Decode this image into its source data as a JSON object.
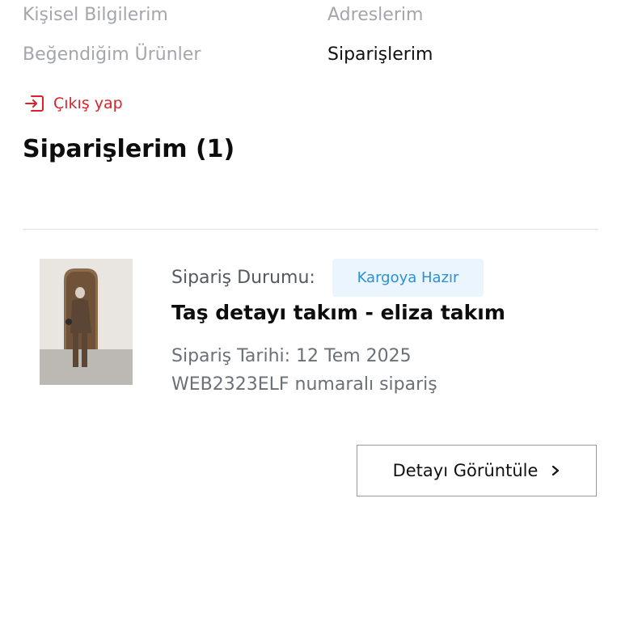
{
  "account_nav": {
    "personal_info": "Kişisel Bilgilerim",
    "addresses": "Adreslerim",
    "liked_products": "Beğendiğim Ürünler",
    "orders": "Siparişlerim",
    "active": "orders"
  },
  "logout": {
    "label": "Çıkış yap",
    "icon": "logout-icon",
    "color": "#d8232a"
  },
  "page": {
    "title": "Siparişlerim (1)"
  },
  "orders": [
    {
      "status_label": "Sipariş Durumu:",
      "status_value": "Kargoya Hazır",
      "status_color": "#2e8fd6",
      "product_name": "Taş detayı takım - eliza takım",
      "order_date": "Sipariş Tarihi: 12 Tem 2025",
      "order_number": "WEB2323ELF numaralı sipariş",
      "image": "product-photo",
      "detail_button": "Detayı Görüntüle",
      "detail_icon": "chevron-right-icon"
    }
  ]
}
